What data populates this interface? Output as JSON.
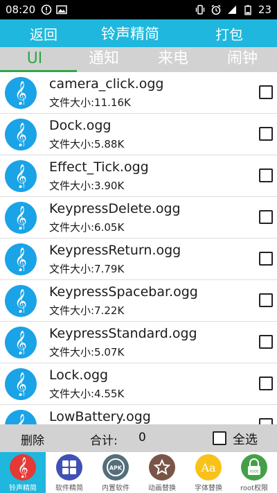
{
  "status_bar": {
    "time": "08:20",
    "battery": "23"
  },
  "titlebar": {
    "back_label": "返回",
    "title": "铃声精简",
    "pack_label": "打包"
  },
  "tabs": [
    {
      "label": "UI",
      "active": true
    },
    {
      "label": "通知",
      "active": false
    },
    {
      "label": "来电",
      "active": false
    },
    {
      "label": "闹钟",
      "active": false
    }
  ],
  "files": [
    {
      "name": "camera_click.ogg",
      "size": "文件大小:11.16K"
    },
    {
      "name": "Dock.ogg",
      "size": "文件大小:5.88K"
    },
    {
      "name": "Effect_Tick.ogg",
      "size": "文件大小:3.90K"
    },
    {
      "name": "KeypressDelete.ogg",
      "size": "文件大小:6.05K"
    },
    {
      "name": "KeypressReturn.ogg",
      "size": "文件大小:7.79K"
    },
    {
      "name": "KeypressSpacebar.ogg",
      "size": "文件大小:7.22K"
    },
    {
      "name": "KeypressStandard.ogg",
      "size": "文件大小:5.07K"
    },
    {
      "name": "Lock.ogg",
      "size": "文件大小:4.55K"
    },
    {
      "name": "LowBattery.ogg",
      "size": ""
    }
  ],
  "actionbar": {
    "delete_label": "删除",
    "total_label": "合计:",
    "count": "0",
    "select_all_label": "全选"
  },
  "bottom_nav": [
    {
      "label": "铃声精简",
      "icon": "music-note-icon",
      "color": "#e53935",
      "active": true
    },
    {
      "label": "软件精简",
      "icon": "apps-grid-icon",
      "color": "#3f51b5",
      "active": false
    },
    {
      "label": "内置软件",
      "icon": "apk-icon",
      "color": "#546e7a",
      "active": false
    },
    {
      "label": "动画替换",
      "icon": "star-icon",
      "color": "#795548",
      "active": false
    },
    {
      "label": "字体替换",
      "icon": "font-icon",
      "color": "#f9c21b",
      "active": false
    },
    {
      "label": "root权限",
      "icon": "lock-icon",
      "color": "#43a047",
      "active": false
    }
  ],
  "icon_texts": {
    "apk": "APK",
    "font": "Aa",
    "root": "root"
  }
}
